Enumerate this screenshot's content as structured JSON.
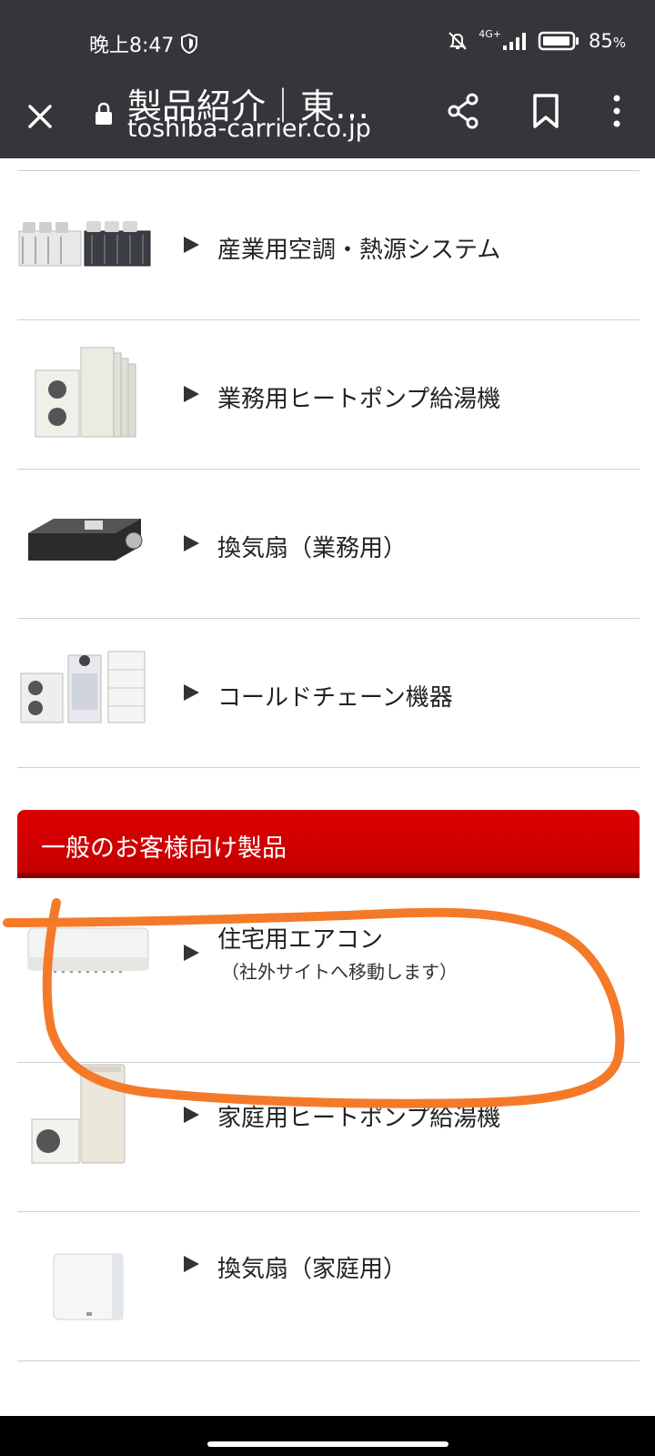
{
  "status_bar": {
    "time": "晚上8:47",
    "network": "4G+",
    "battery": "85",
    "battery_unit": "%"
  },
  "browser": {
    "page_title": "製品紹介｜東…",
    "domain": "toshiba-carrier.co.jp",
    "icons": [
      "close-icon",
      "lock-icon",
      "share-icon",
      "bookmark-icon",
      "more-vert-icon"
    ]
  },
  "business_products": [
    {
      "label": "産業用空調・熱源システム",
      "thumb": "industrial-chiller-image"
    },
    {
      "label": "業務用ヒートポンプ給湯機",
      "thumb": "commercial-heat-pump-image"
    },
    {
      "label": "換気扇（業務用）",
      "thumb": "commercial-ventilation-fan-image"
    },
    {
      "label": "コールドチェーン機器",
      "thumb": "cold-chain-equipment-image"
    }
  ],
  "consumer_section": {
    "title": "一般のお客様向け製品"
  },
  "consumer_products": [
    {
      "label": "住宅用エアコン",
      "sub": "（社外サイトへ移動します）",
      "thumb": "residential-air-conditioner-image"
    },
    {
      "label": "家庭用ヒートポンプ給湯機",
      "thumb": "home-heat-pump-water-heater-image"
    },
    {
      "label": "換気扇（家庭用）",
      "thumb": "home-ventilation-fan-image"
    }
  ],
  "colors": {
    "browser_bar": "#35363a",
    "section_red": "#d40000",
    "annotation_orange": "#f47a2a"
  }
}
